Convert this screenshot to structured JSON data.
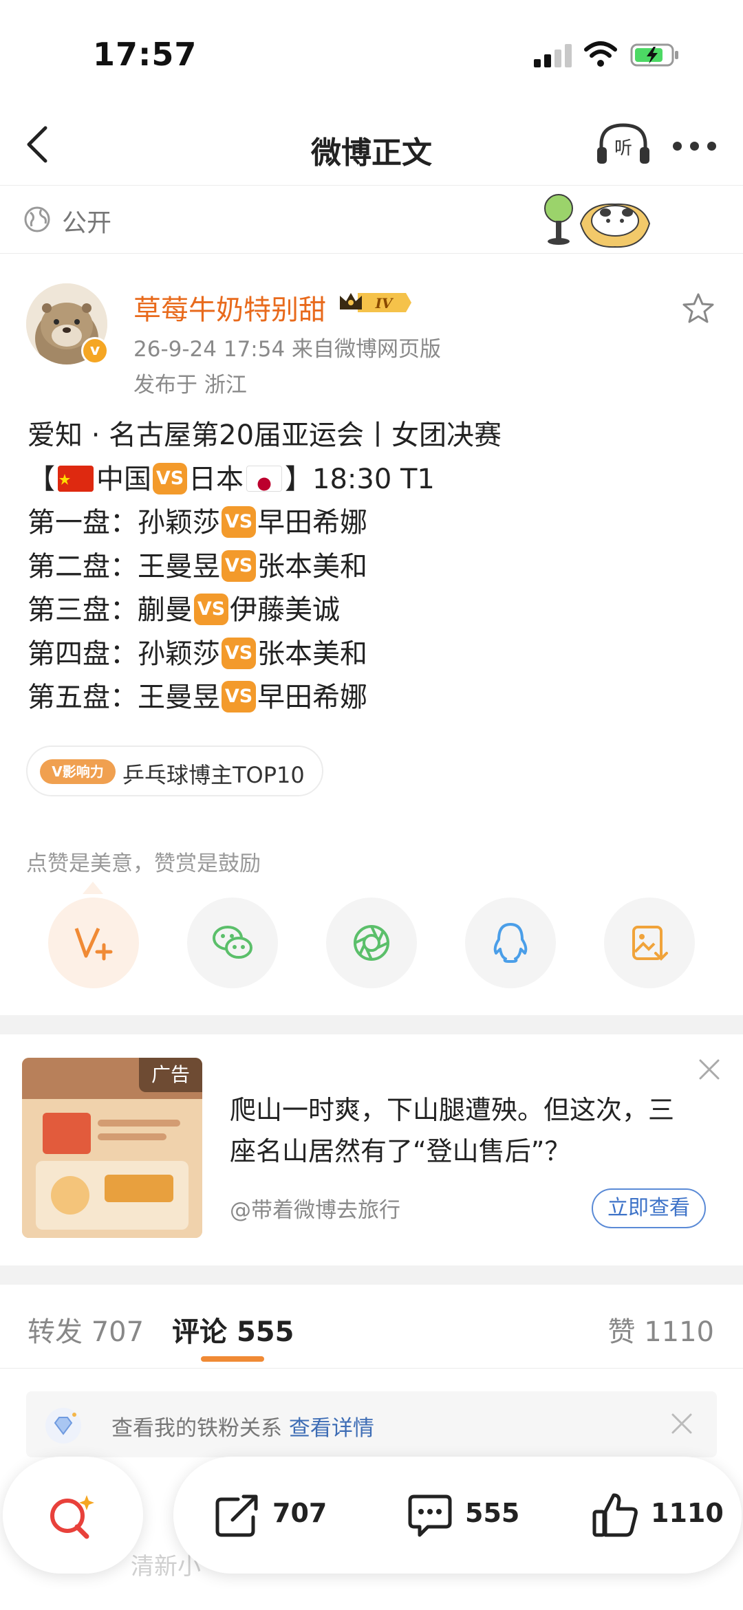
{
  "status_bar": {
    "time": "17:57"
  },
  "nav": {
    "title": "微博正文",
    "listen_label": "听"
  },
  "visibility": {
    "label": "公开"
  },
  "author": {
    "name": "草莓牛奶特别甜",
    "level": "IV",
    "verified_mark": "v",
    "meta": "26-9-24 17:54  来自微博网页版",
    "location": "发布于 浙江"
  },
  "post": {
    "line1": "爱知 · 名古屋第20届亚运会丨女团决赛",
    "match": {
      "prefix": "【",
      "team_a": "中国",
      "team_b": "日本",
      "suffix": "】18:30 T1"
    },
    "vs_label": "VS",
    "games": [
      {
        "label": "第一盘：",
        "player_a": "孙颖莎",
        "player_b": "早田希娜"
      },
      {
        "label": "第二盘：",
        "player_a": "王曼昱",
        "player_b": "张本美和"
      },
      {
        "label": "第三盘：",
        "player_a": "蒯曼",
        "player_b": "伊藤美诚"
      },
      {
        "label": "第四盘：",
        "player_a": "孙颖莎",
        "player_b": "张本美和"
      },
      {
        "label": "第五盘：",
        "player_a": "王曼昱",
        "player_b": "早田希娜"
      }
    ]
  },
  "influence": {
    "logo": "V影响力",
    "text": "乒乓球博主TOP10"
  },
  "appreciation": {
    "label": "点赞是美意，赞赏是鼓励"
  },
  "share_icons": [
    "reward-icon",
    "wechat-icon",
    "moments-icon",
    "qq-icon",
    "save-image-icon"
  ],
  "ad": {
    "badge": "广告",
    "title": "爬山一时爽，下山腿遭殃。但这次，三座名山居然有了“登山售后”？",
    "source": "@带着微博去旅行",
    "cta": "立即查看"
  },
  "tabs": {
    "repost_label": "转发",
    "repost_count": "707",
    "comment_label": "评论",
    "comment_count": "555",
    "like_label": "赞",
    "like_count": "1110"
  },
  "fan_banner": {
    "text": "查看我的铁粉关系 ",
    "link": "查看详情"
  },
  "comment_peek": "清新小",
  "bottom_bar": {
    "repost_count": "707",
    "comment_count": "555",
    "like_count": "1110"
  },
  "colors": {
    "accent": "#e86a1c",
    "vs_badge": "#f39a2b",
    "link": "#3e6db5"
  }
}
